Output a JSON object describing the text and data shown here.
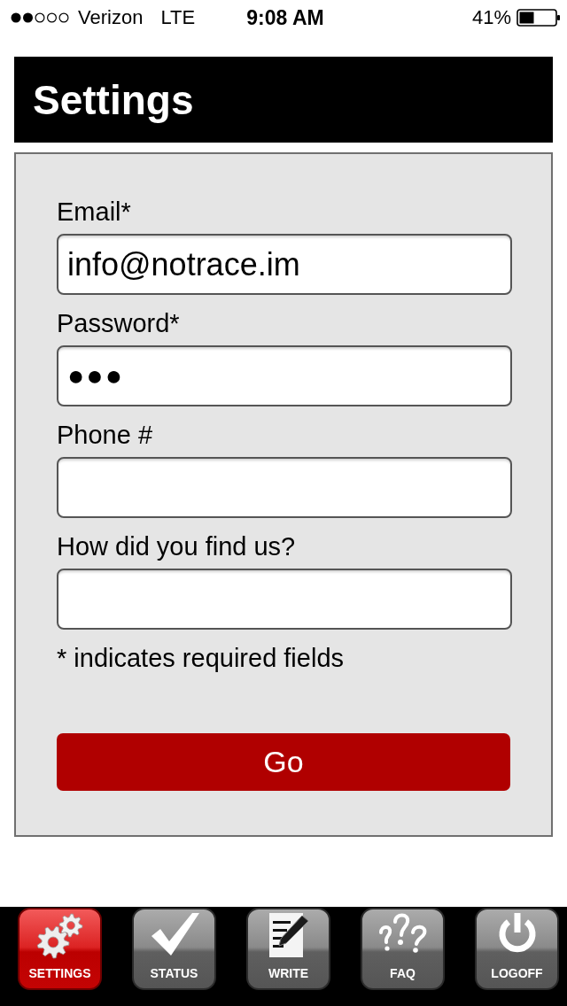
{
  "status_bar": {
    "carrier": "Verizon",
    "network": "LTE",
    "time": "9:08 AM",
    "battery": "41%"
  },
  "header": {
    "title": "Settings"
  },
  "form": {
    "fields": [
      {
        "label": "Email*",
        "kind": "text",
        "value": "info@notrace.im"
      },
      {
        "label": "Password*",
        "kind": "password",
        "value": "●●●"
      },
      {
        "label": "Phone #",
        "kind": "text"
      },
      {
        "label": "How did you find us?",
        "kind": "text"
      }
    ],
    "note": "* indicates required fields",
    "submit": "Go"
  },
  "tab_bar": {
    "items": [
      {
        "label": "SETTINGS",
        "selected": true
      },
      {
        "label": "STATUS",
        "selected": false
      },
      {
        "label": "WRITE",
        "selected": false
      },
      {
        "label": "FAQ",
        "selected": false
      },
      {
        "label": "LOGOFF",
        "selected": false
      }
    ]
  }
}
